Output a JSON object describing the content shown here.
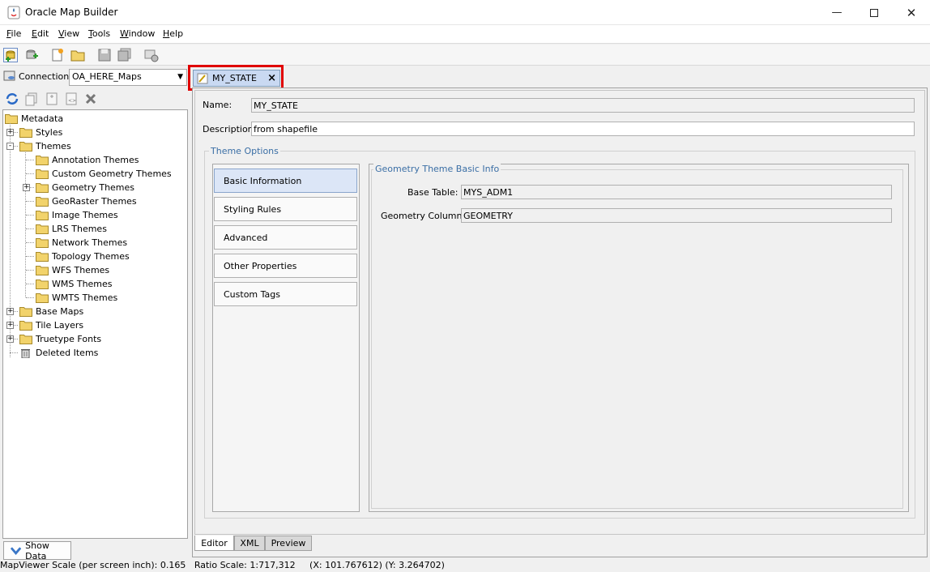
{
  "window": {
    "title": "Oracle Map Builder",
    "controls": [
      "minimize-icon",
      "maximize-icon",
      "close-icon"
    ]
  },
  "menu": [
    {
      "label": "File",
      "mnemonic": "F",
      "rest": "ile"
    },
    {
      "label": "Edit",
      "mnemonic": "E",
      "rest": "dit"
    },
    {
      "label": "View",
      "mnemonic": "V",
      "rest": "iew"
    },
    {
      "label": "Tools",
      "mnemonic": "T",
      "rest": "ools"
    },
    {
      "label": "Window",
      "mnemonic": "W",
      "rest": "indow"
    },
    {
      "label": "Help",
      "mnemonic": "H",
      "rest": "elp"
    }
  ],
  "toolbar": {
    "icons": [
      "new-connection-icon",
      "import-icon",
      "new-icon",
      "open-folder-icon",
      "save-icon",
      "save-all-icon",
      "settings-icon"
    ]
  },
  "connection": {
    "label": "Connection:",
    "value": "OA_HERE_Maps"
  },
  "left_toolbar": {
    "icons": [
      "refresh-icon",
      "copy-icon",
      "paste-icon",
      "rename-icon",
      "delete-icon"
    ]
  },
  "tree": {
    "root": "Metadata",
    "items": [
      {
        "label": "Styles",
        "level": 1,
        "expander": "+"
      },
      {
        "label": "Themes",
        "level": 1,
        "expander": "-"
      },
      {
        "label": "Annotation Themes",
        "level": 2,
        "expander": ""
      },
      {
        "label": "Custom Geometry Themes",
        "level": 2,
        "expander": ""
      },
      {
        "label": "Geometry Themes",
        "level": 2,
        "expander": "+"
      },
      {
        "label": "GeoRaster Themes",
        "level": 2,
        "expander": ""
      },
      {
        "label": "Image Themes",
        "level": 2,
        "expander": ""
      },
      {
        "label": "LRS Themes",
        "level": 2,
        "expander": ""
      },
      {
        "label": "Network Themes",
        "level": 2,
        "expander": ""
      },
      {
        "label": "Topology Themes",
        "level": 2,
        "expander": ""
      },
      {
        "label": "WFS Themes",
        "level": 2,
        "expander": ""
      },
      {
        "label": "WMS Themes",
        "level": 2,
        "expander": ""
      },
      {
        "label": "WMTS Themes",
        "level": 2,
        "expander": ""
      },
      {
        "label": "Base Maps",
        "level": 1,
        "expander": "+"
      },
      {
        "label": "Tile Layers",
        "level": 1,
        "expander": "+"
      },
      {
        "label": "Truetype Fonts",
        "level": 1,
        "expander": "+"
      },
      {
        "label": "Deleted Items",
        "level": 1,
        "expander": "",
        "icon": "trash-icon"
      }
    ]
  },
  "show_data_label": "Show Data",
  "editor_tab": {
    "label": "MY_STATE",
    "close": "×"
  },
  "form": {
    "name_label": "Name:",
    "name_value": "MY_STATE",
    "description_label": "Description:",
    "description_value": "from shapefile",
    "theme_options_title": "Theme Options",
    "nav": [
      "Basic Information",
      "Styling Rules",
      "Advanced",
      "Other Properties",
      "Custom Tags"
    ],
    "geom_group_title": "Geometry Theme Basic Info",
    "base_table_label": "Base Table:",
    "base_table_value": "MYS_ADM1",
    "geometry_column_label": "Geometry Column:",
    "geometry_column_value": "GEOMETRY"
  },
  "bottom_tabs": [
    "Editor",
    "XML",
    "Preview"
  ],
  "status": {
    "text": "MapViewer Scale (per screen inch): 0.165   Ratio Scale: 1:717,312     (X: 101.767612) (Y: 3.264702)"
  }
}
